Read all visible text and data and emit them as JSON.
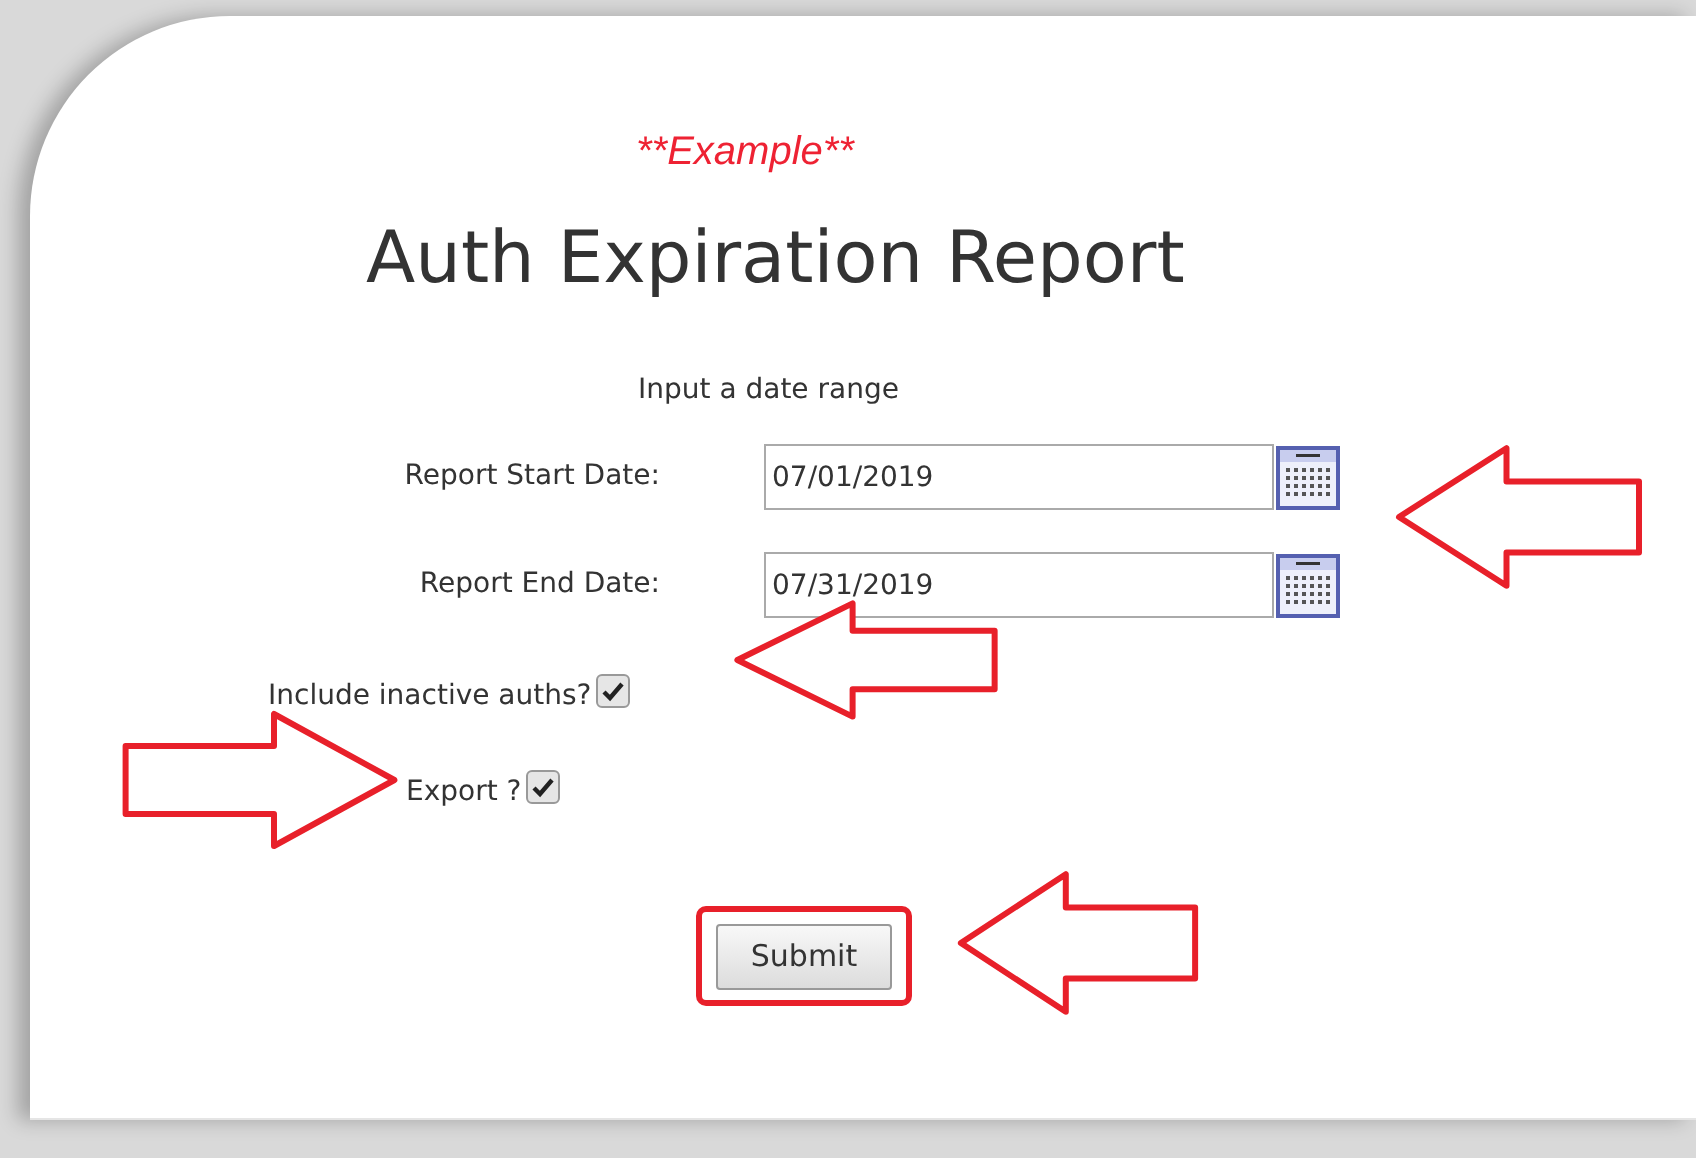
{
  "example_note": "**Example**",
  "title": "Auth Expiration Report",
  "instructions": "Input a date range",
  "date_fields": [
    {
      "label": "Report Start Date:",
      "value": "07/01/2019"
    },
    {
      "label": "Report End Date:",
      "value": "07/31/2019"
    }
  ],
  "checkboxes": [
    {
      "label": "Include inactive auths?",
      "checked": true
    },
    {
      "label": "Export ?",
      "checked": true
    }
  ],
  "submit_button": "Submit"
}
